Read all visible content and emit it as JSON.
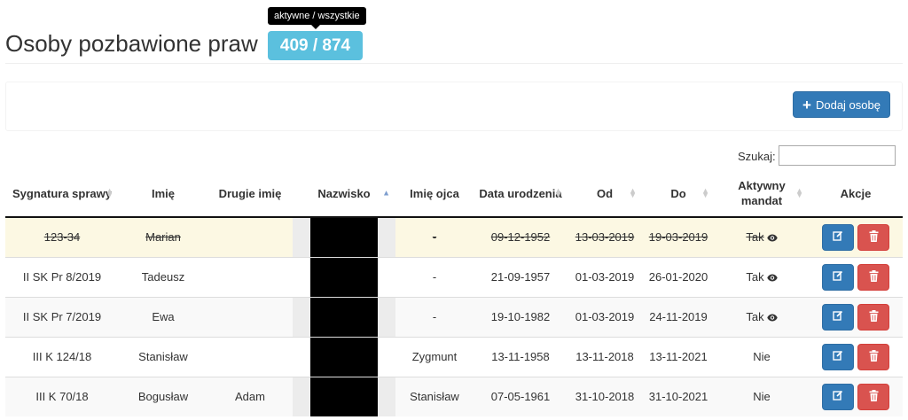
{
  "header": {
    "title": "Osoby pozbawione praw",
    "count_badge": "409 / 874",
    "tooltip": "aktywne / wszystkie"
  },
  "toolbar": {
    "add_label": "Dodaj osobę"
  },
  "search": {
    "label": "Szukaj:",
    "value": ""
  },
  "table": {
    "columns": {
      "sygnatura": "Sygnatura sprawy",
      "imie": "Imię",
      "drugie_imie": "Drugie imię",
      "nazwisko": "Nazwisko",
      "imie_ojca": "Imię ojca",
      "data_urodzenia": "Data urodzenia",
      "od": "Od",
      "do": "Do",
      "aktywny_mandat": "Aktywny mandat",
      "akcje": "Akcje"
    },
    "rows": [
      {
        "sygnatura": "123-34",
        "imie": "Marian",
        "drugie_imie": "",
        "nazwisko": "",
        "imie_ojca": "-",
        "data_urodzenia": "09-12-1952",
        "od": "13-03-2019",
        "do": "19-03-2019",
        "mandat": "Tak",
        "mandat_eye": true,
        "inactive": true
      },
      {
        "sygnatura": "II SK Pr 8/2019",
        "imie": "Tadeusz",
        "drugie_imie": "",
        "nazwisko": "",
        "imie_ojca": "-",
        "data_urodzenia": "21-09-1957",
        "od": "01-03-2019",
        "do": "26-01-2020",
        "mandat": "Tak",
        "mandat_eye": true,
        "inactive": false
      },
      {
        "sygnatura": "II SK Pr 7/2019",
        "imie": "Ewa",
        "drugie_imie": "",
        "nazwisko": "",
        "imie_ojca": "-",
        "data_urodzenia": "19-10-1982",
        "od": "01-03-2019",
        "do": "24-11-2019",
        "mandat": "Tak",
        "mandat_eye": true,
        "inactive": false
      },
      {
        "sygnatura": "III K 124/18",
        "imie": "Stanisław",
        "drugie_imie": "",
        "nazwisko": "",
        "imie_ojca": "Zygmunt",
        "data_urodzenia": "13-11-1958",
        "od": "13-11-2018",
        "do": "13-11-2021",
        "mandat": "Nie",
        "mandat_eye": false,
        "inactive": false
      },
      {
        "sygnatura": "III K 70/18",
        "imie": "Bogusław",
        "drugie_imie": "Adam",
        "nazwisko": "",
        "imie_ojca": "Stanisław",
        "data_urodzenia": "07-05-1961",
        "od": "31-10-2018",
        "do": "31-10-2021",
        "mandat": "Nie",
        "mandat_eye": false,
        "inactive": false
      }
    ]
  },
  "icons": {
    "add": "plus-icon",
    "view": "eye-icon",
    "edit": "edit-icon",
    "delete": "trash-icon",
    "sort": "sort-icon"
  },
  "colors": {
    "badge": "#5bc0de",
    "primary": "#337ab7",
    "danger": "#d9534f",
    "inactive_row": "#fcf8e3"
  }
}
